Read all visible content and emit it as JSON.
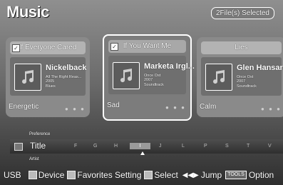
{
  "header": {
    "title": "Music",
    "selected_badge": "2File(s) Selected"
  },
  "cards": [
    {
      "song": "If Everyone Cared",
      "artist": "Nickelback",
      "album": "All The Right Reas...",
      "year": "2005",
      "genre": "Blues",
      "mood": "Energetic",
      "checked": true
    },
    {
      "song": "If You Want Me",
      "artist": "Marketa Irgl...",
      "album": "Once Ost",
      "year": "2007",
      "genre": "Soundtrack",
      "mood": "Sad",
      "checked": true
    },
    {
      "song": "Lies",
      "artist": "Glen Hansard",
      "album": "Once Ost",
      "year": "2007",
      "genre": "Soundtrack",
      "mood": "Calm",
      "checked": false
    }
  ],
  "sort_bar": {
    "preference_label": "Preference",
    "current_sort": "Title",
    "artist_label": "Artist",
    "letters": [
      "F",
      "G",
      "H",
      "I",
      "J",
      "L",
      "P",
      "S",
      "T",
      "V"
    ],
    "active_letter": "I"
  },
  "footer": {
    "source": "USB",
    "device": "Device",
    "favorites": "Favorites Setting",
    "select": "Select",
    "jump": "Jump",
    "tools_key": "TOOLS",
    "option": "Option"
  }
}
